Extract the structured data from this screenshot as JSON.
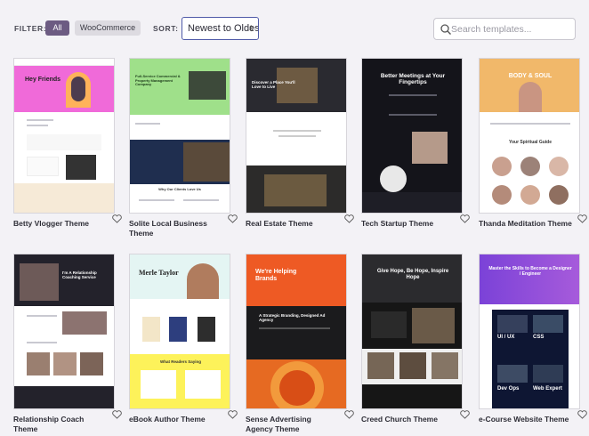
{
  "filter": {
    "label": "FILTER:",
    "options": [
      "All",
      "WooCommerce"
    ],
    "active": "All"
  },
  "sort": {
    "label": "SORT:",
    "value": "Newest to Oldest"
  },
  "search": {
    "placeholder": "Search templates..."
  },
  "templates": [
    {
      "title": "Betty Vlogger Theme",
      "thumb_heading": "Hey Friends"
    },
    {
      "title": "Solite Local Business Theme",
      "thumb_heading": "Full-Service Commercial & Property Management Company",
      "thumb_subheading": "Why Our Clients Love Us"
    },
    {
      "title": "Real Estate Theme",
      "thumb_heading": "Discover a Place You'll Love to Live"
    },
    {
      "title": "Tech Startup Theme",
      "thumb_heading": "Better Meetings at Your Fingertips"
    },
    {
      "title": "Thanda Meditation Theme",
      "thumb_heading": "BODY & SOUL",
      "thumb_subheading": "Your Spiritual Guide"
    },
    {
      "title": "Relationship Coach Theme",
      "thumb_heading": "I'm A Relationship Coaching Service"
    },
    {
      "title": "eBook Author Theme",
      "thumb_heading": "Merle Taylor",
      "thumb_subheading": "What Readers Saying"
    },
    {
      "title": "Sense Advertising Agency Theme",
      "thumb_heading": "We're Helping Brands",
      "thumb_subheading": "A Strategic Branding, Designed Ad Agency"
    },
    {
      "title": "Creed Church Theme",
      "thumb_heading": "Give Hope, Be Hope, Inspire Hope"
    },
    {
      "title": "e-Course Website Theme",
      "thumb_heading": "Master the Skills to Become a Designer / Engineer",
      "thumb_tiles": [
        "UI / UX",
        "CSS",
        "Dev Ops",
        "Web Expert"
      ]
    }
  ],
  "colors": {
    "accent": "#6c5b82",
    "sort_border": "#4f5aa8"
  }
}
